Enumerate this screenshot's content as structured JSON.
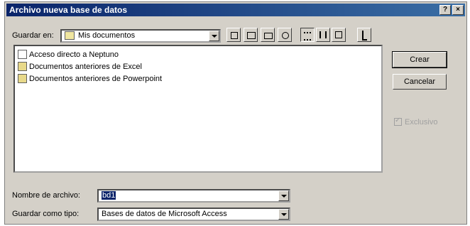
{
  "window": {
    "title": "Archivo nueva base de datos"
  },
  "title_buttons": {
    "help": "?",
    "close": "×"
  },
  "location": {
    "label": "Guardar en:",
    "value": "Mis documentos"
  },
  "toolbar": {
    "icons": [
      "back-icon",
      "up-folder-icon",
      "new-folder-icon",
      "list-view-icon",
      "details-view-icon",
      "properties-view-icon",
      "tools-icon"
    ]
  },
  "files": [
    {
      "name": "Acceso directo a Neptuno",
      "type": "shortcut"
    },
    {
      "name": "Documentos anteriores de Excel",
      "type": "folder"
    },
    {
      "name": "Documentos anteriores de Powerpoint",
      "type": "folder"
    }
  ],
  "buttons": {
    "create": "Crear",
    "cancel": "Cancelar"
  },
  "exclusive": {
    "label": "Exclusivo",
    "checked": true,
    "enabled": false
  },
  "filename": {
    "label": "Nombre de archivo:",
    "value": "bd1"
  },
  "filetype": {
    "label": "Guardar como tipo:",
    "value": "Bases de datos de Microsoft Access"
  }
}
